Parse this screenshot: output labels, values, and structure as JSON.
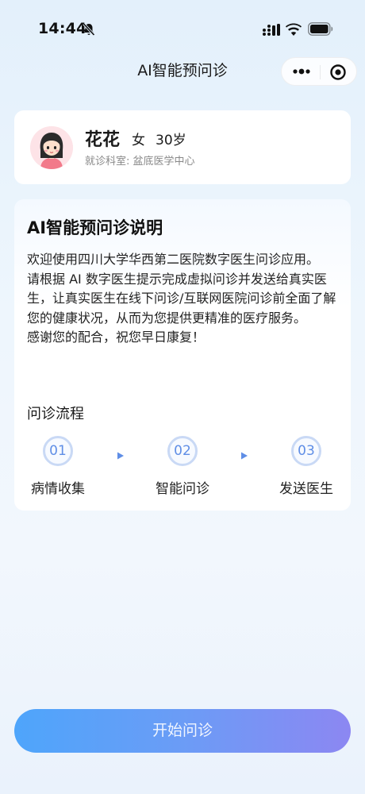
{
  "status_bar": {
    "time": "14:44",
    "icons": [
      "bell-muted-icon",
      "signal-icon",
      "wifi-icon",
      "battery-icon"
    ]
  },
  "nav": {
    "title": "AI智能预问诊",
    "capsule_icons": [
      "more-icon",
      "close-circle-icon"
    ]
  },
  "patient": {
    "name": "花花",
    "gender": "女",
    "age": "30岁",
    "department": "就诊科室: 盆底医学中心"
  },
  "info": {
    "title": "AI智能预问诊说明",
    "paragraphs": [
      "欢迎使用四川大学华西第二医院数字医生问诊应用。",
      "请根据 AI 数字医生提示完成虚拟问诊并发送给真实医生，让真实医生在线下问诊/互联网医院问诊前全面了解您的健康状况，从而为您提供更精准的医疗服务。",
      "感谢您的配合，祝您早日康复！"
    ],
    "flow_title": "问诊流程",
    "steps": [
      {
        "number": "01",
        "label": "病情收集"
      },
      {
        "number": "02",
        "label": "智能问诊"
      },
      {
        "number": "03",
        "label": "发送医生"
      }
    ]
  },
  "start_button": {
    "label": "开始问诊"
  },
  "colors": {
    "accent_start": "#4ea5fb",
    "accent_end": "#8c87f2",
    "step_text": "#5f8ee6"
  }
}
